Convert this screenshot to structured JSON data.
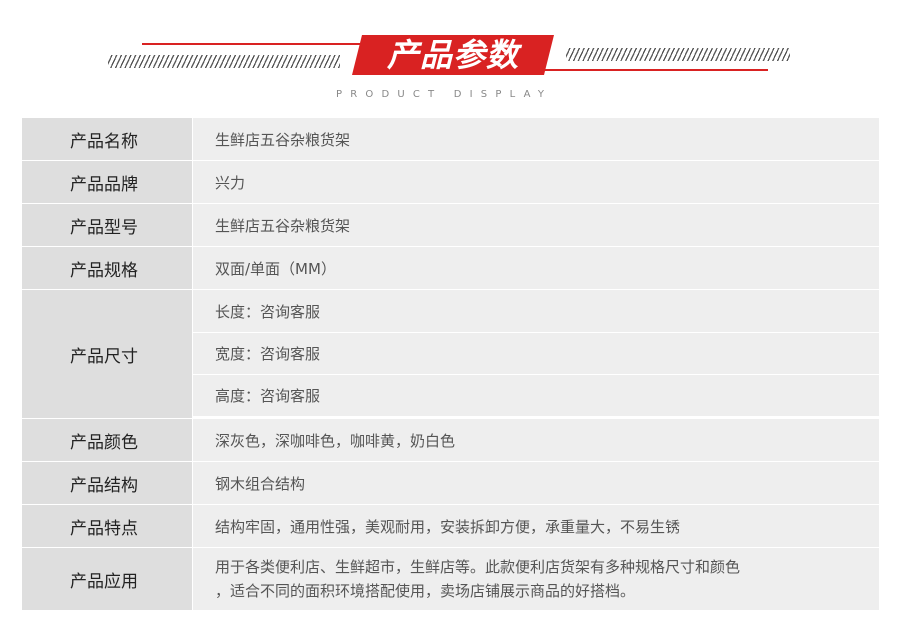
{
  "header": {
    "title": "产品参数",
    "subtitle": "PRODUCT DISPLAY",
    "accent_color": "#d92222"
  },
  "rows": [
    {
      "label": "产品名称",
      "value": "生鲜店五谷杂粮货架"
    },
    {
      "label": "产品品牌",
      "value": "兴力"
    },
    {
      "label": "产品型号",
      "value": "生鲜店五谷杂粮货架"
    },
    {
      "label": "产品规格",
      "value": "双面/单面（MM）"
    },
    {
      "label": "产品尺寸",
      "values": [
        "长度：咨询客服",
        "宽度：咨询客服",
        "高度：咨询客服"
      ]
    },
    {
      "label": "产品颜色",
      "value": "深灰色，深咖啡色，咖啡黄，奶白色"
    },
    {
      "label": "产品结构",
      "value": "钢木组合结构"
    },
    {
      "label": "产品特点",
      "value": "结构牢固，通用性强，美观耐用，安装拆卸方便，承重量大，不易生锈"
    },
    {
      "label": "产品应用",
      "lines": [
        "用于各类便利店、生鲜超市，生鲜店等。此款便利店货架有多种规格尺寸和颜色",
        "，适合不同的面积环境搭配使用，卖场店铺展示商品的好搭档。"
      ]
    }
  ]
}
